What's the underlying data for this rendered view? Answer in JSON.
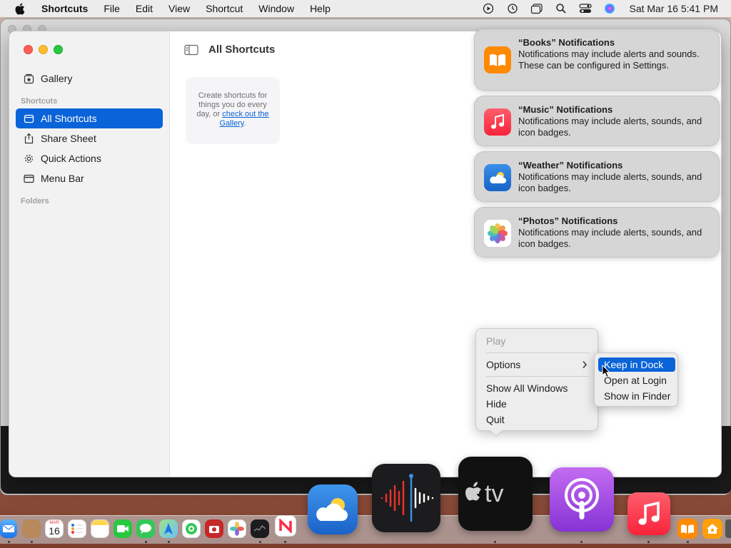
{
  "menubar": {
    "apple_icon": "apple-logo-icon",
    "app_name": "Shortcuts",
    "items": [
      "File",
      "Edit",
      "View",
      "Shortcut",
      "Window",
      "Help"
    ],
    "status_icons": [
      "play-circle-icon",
      "time-machine-icon",
      "window-stack-icon",
      "search-icon",
      "control-center-icon",
      "siri-icon"
    ],
    "clock": "Sat Mar 16  5:41 PM"
  },
  "sidebar": {
    "gallery": "Gallery",
    "section_shortcuts": "Shortcuts",
    "items": [
      {
        "label": "All Shortcuts",
        "icon": "all-shortcuts-icon",
        "active": true
      },
      {
        "label": "Share Sheet",
        "icon": "share-icon",
        "active": false
      },
      {
        "label": "Quick Actions",
        "icon": "gear-icon",
        "active": false
      },
      {
        "label": "Menu Bar",
        "icon": "menu-bar-icon",
        "active": false
      }
    ],
    "section_folders": "Folders"
  },
  "main": {
    "title": "All Shortcuts",
    "empty_text": "Create shortcuts for things you do every day, or ",
    "empty_link": "check out the Gallery",
    "empty_suffix": "."
  },
  "notifications": [
    {
      "app": "Books",
      "title": "“Books” Notifications",
      "body": "Notifications may include alerts and sounds. These can be configured in Settings.",
      "color": "#ff8a00"
    },
    {
      "app": "Music",
      "title": "“Music” Notifications",
      "body": "Notifications may include alerts, sounds, and icon badges.",
      "color": "#fc3c44"
    },
    {
      "app": "Weather",
      "title": "“Weather” Notifications",
      "body": "Notifications may include alerts, sounds, and icon badges.",
      "color": "#1f7ae0"
    },
    {
      "app": "Photos",
      "title": "“Photos” Notifications",
      "body": "Notifications may include alerts, sounds, and icon badges.",
      "color": "#ffffff"
    }
  ],
  "context_menu": {
    "play": "Play",
    "options": "Options",
    "show_all": "Show All Windows",
    "hide": "Hide",
    "quit": "Quit"
  },
  "submenu": {
    "keep_in_dock": "Keep in Dock",
    "open_at_login": "Open at Login",
    "show_in_finder": "Show in Finder"
  },
  "dock": {
    "calendar_month": "MAR",
    "calendar_day": "16",
    "apps": [
      "mail",
      "notes-folder",
      "calendar",
      "reminders",
      "notes",
      "facetime",
      "messages",
      "maps",
      "find-my",
      "photo-booth",
      "photos",
      "stocks",
      "news",
      "weather",
      "voice-memos",
      "apple-tv",
      "podcasts",
      "music",
      "books",
      "home"
    ]
  },
  "colors": {
    "accent": "#0a63d8",
    "sidebar_bg": "#f2f2f2",
    "notif_bg": "#d2d2d2"
  }
}
